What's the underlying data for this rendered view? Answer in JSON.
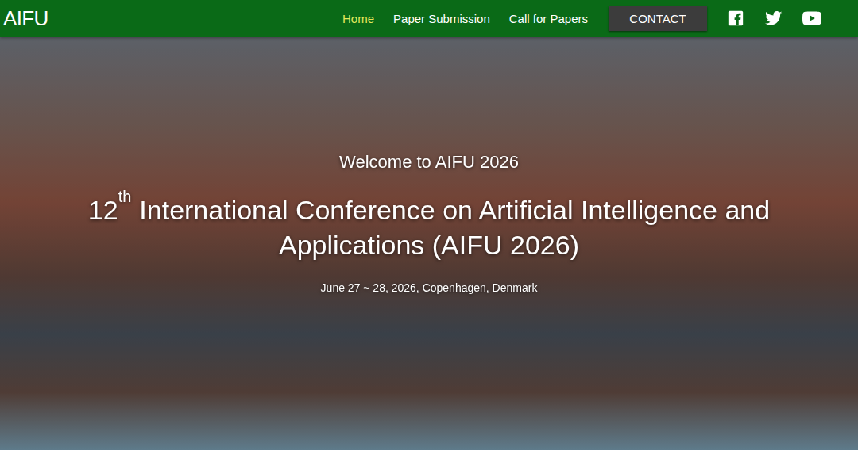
{
  "header": {
    "logo": "AIFU",
    "nav": [
      {
        "label": "Home",
        "selected": true
      },
      {
        "label": "Paper Submission",
        "selected": false
      },
      {
        "label": "Call for Papers",
        "selected": false
      }
    ],
    "contact": "CONTACT"
  },
  "hero": {
    "welcome": "Welcome to AIFU 2026",
    "title": {
      "number": "12",
      "suffix": "th",
      "text": "International Conference on Artificial Intelligence and Applications (AIFU 2026)"
    },
    "date": "June 27 ~ 28, 2026, Copenhagen, Denmark"
  }
}
